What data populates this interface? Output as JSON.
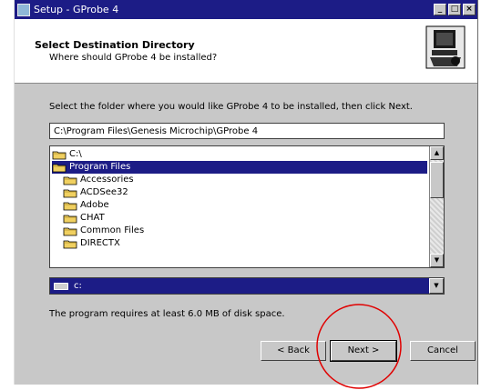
{
  "window": {
    "title": "Setup - GProbe 4",
    "minimize_label": "_",
    "maximize_label": "□",
    "close_label": "×"
  },
  "header": {
    "title": "Select Destination Directory",
    "subtitle": "Where should GProbe 4 be installed?"
  },
  "body": {
    "instruction": "Select the folder where you would like GProbe 4 to be installed, then click Next.",
    "path_value": "C:\\Program Files\\Genesis Microchip\\GProbe 4",
    "folders": [
      {
        "label": "C:\\",
        "selected": false,
        "indent": 0
      },
      {
        "label": "Program Files",
        "selected": true,
        "indent": 0
      },
      {
        "label": "Accessories",
        "selected": false,
        "indent": 1
      },
      {
        "label": "ACDSee32",
        "selected": false,
        "indent": 1
      },
      {
        "label": "Adobe",
        "selected": false,
        "indent": 1
      },
      {
        "label": "CHAT",
        "selected": false,
        "indent": 1
      },
      {
        "label": "Common Files",
        "selected": false,
        "indent": 1
      },
      {
        "label": "DIRECTX",
        "selected": false,
        "indent": 1
      }
    ],
    "drive_value": "c:",
    "space_note": "The program requires at least 6.0 MB of disk space."
  },
  "buttons": {
    "back": "< Back",
    "next": "Next >",
    "cancel": "Cancel"
  },
  "colors": {
    "selection": "#1c1c86",
    "annotation_circle": "#e00000"
  }
}
